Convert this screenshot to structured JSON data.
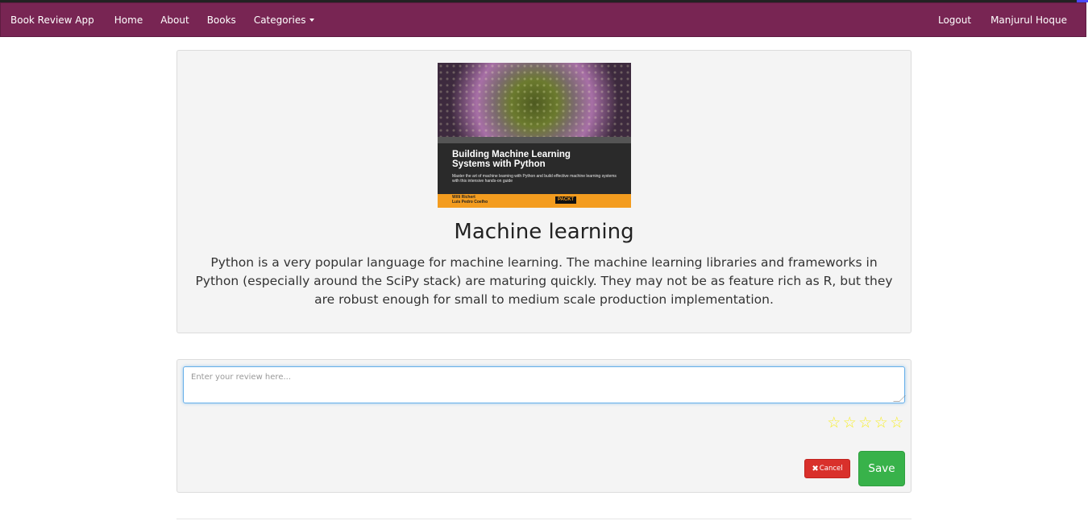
{
  "navbar": {
    "brand": "Book Review App",
    "links": [
      "Home",
      "About",
      "Books",
      "Categories"
    ],
    "right_links": [
      "Logout",
      "Manjurul Hoque"
    ],
    "bg_color": "#782553"
  },
  "book": {
    "cover": {
      "title_line1": "Building Machine Learning",
      "title_line2": "Systems with Python",
      "subtitle": "Master the art of machine learning with Python and build effective machine learning systems with this intensive hands-on guide",
      "author1": "Willi Richert",
      "author2": "Luis Pedro Coelho",
      "publisher": "PACKT"
    },
    "title": "Machine learning",
    "description": "Python is a very popular language for machine learning. The machine learning libraries and frameworks in Python (especially around the SciPy stack) are maturing quickly. They may not be as feature rich as R, but they are robust enough for small to medium scale production implementation."
  },
  "review": {
    "placeholder": "Enter your review here...",
    "value": "",
    "rating": 0,
    "max_rating": 5,
    "star_glyph": "☆",
    "star_color": "#f7ee2a",
    "cancel_icon": "✖",
    "cancel_label": "Cancel",
    "save_label": "Save",
    "cancel_color": "#d9302b",
    "save_color": "#38b24a"
  }
}
